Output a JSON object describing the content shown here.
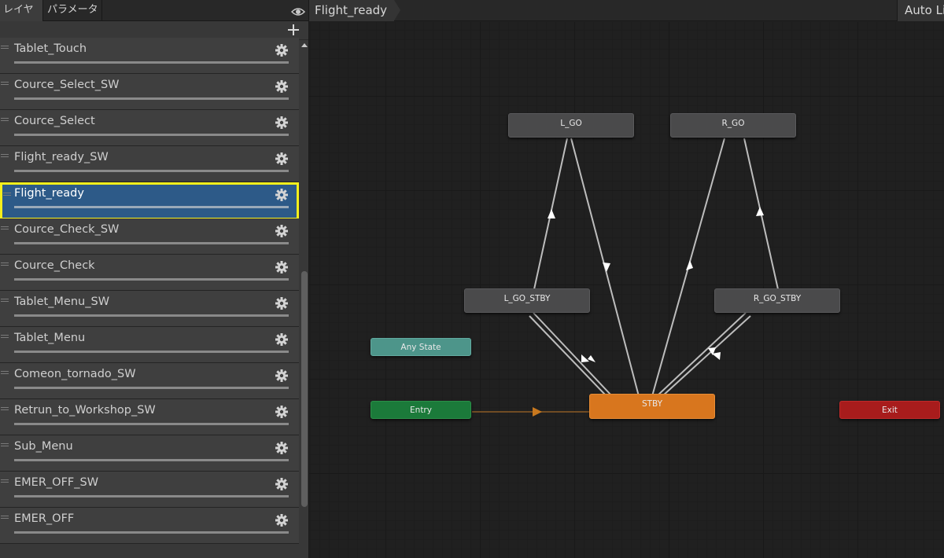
{
  "left_panel": {
    "tabs": {
      "layers": "レイヤー",
      "parameters": "パラメーター"
    },
    "layers": [
      {
        "name": "Tablet_Touch",
        "selected": false
      },
      {
        "name": "Cource_Select_SW",
        "selected": false
      },
      {
        "name": "Cource_Select",
        "selected": false
      },
      {
        "name": "Flight_ready_SW",
        "selected": false
      },
      {
        "name": "Flight_ready",
        "selected": true
      },
      {
        "name": "Cource_Check_SW",
        "selected": false
      },
      {
        "name": "Cource_Check",
        "selected": false
      },
      {
        "name": "Tablet_Menu_SW",
        "selected": false
      },
      {
        "name": "Tablet_Menu",
        "selected": false
      },
      {
        "name": "Comeon_tornado_SW",
        "selected": false
      },
      {
        "name": "Retrun_to_Workshop_SW",
        "selected": false
      },
      {
        "name": "Sub_Menu",
        "selected": false
      },
      {
        "name": "EMER_OFF_SW",
        "selected": false
      },
      {
        "name": "EMER_OFF",
        "selected": false
      }
    ],
    "highlight_color": "#f5ef1c",
    "selected_row_color": "#2d5a88"
  },
  "graph": {
    "breadcrumb": "Flight_ready",
    "auto_live": "Auto Live Link",
    "nodes": {
      "l_go": "L_GO",
      "r_go": "R_GO",
      "l_go_stby": "L_GO_STBY",
      "r_go_stby": "R_GO_STBY",
      "any_state": "Any State",
      "entry": "Entry",
      "stby": "STBY",
      "exit": "Exit"
    },
    "colors": {
      "state": "#4a4a4b",
      "any_state": "#4d958a",
      "entry": "#1b7a3a",
      "default_state": "#d8761e",
      "exit": "#a81c1c",
      "transition": "#bdbdbd",
      "entry_transition": "#c8781e"
    }
  }
}
